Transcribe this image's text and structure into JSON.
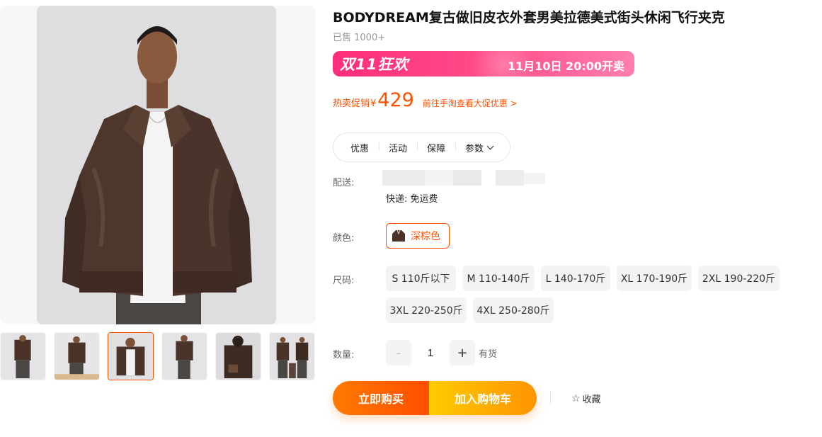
{
  "product": {
    "title": "BODYDREAM复古做旧皮衣外套男美拉德美式街头休闲飞行夹克",
    "sold": "已售 1000+"
  },
  "promo": {
    "logo": "双11狂欢",
    "date_text": "11月10日 20:00开卖"
  },
  "price": {
    "label": "热卖促销",
    "currency": "¥",
    "value": "429",
    "link": "前往手淘查看大促优惠 >"
  },
  "tabs": [
    {
      "label": "优惠"
    },
    {
      "label": "活动"
    },
    {
      "label": "保障"
    },
    {
      "label": "参数"
    }
  ],
  "shipping": {
    "label": "配送:",
    "method": "快递: 免运费"
  },
  "color": {
    "label": "颜色:",
    "selected": "深棕色"
  },
  "size": {
    "label": "尺码:",
    "options": [
      "S 110斤以下",
      "M 110-140斤",
      "L 140-170斤",
      "XL 170-190斤",
      "2XL 190-220斤",
      "3XL 220-250斤",
      "4XL 250-280斤"
    ]
  },
  "quantity": {
    "label": "数量:",
    "minus": "-",
    "plus": "+",
    "value": "1",
    "stock": "有货"
  },
  "actions": {
    "buy_now": "立即购买",
    "add_to_cart": "加入购物车",
    "favorite": "收藏"
  },
  "thumbnails": {
    "count": 6,
    "active_index": 2
  },
  "colors": {
    "accent": "#ff5000",
    "promo": "#ff2d7a",
    "leather": "#4a342a"
  }
}
